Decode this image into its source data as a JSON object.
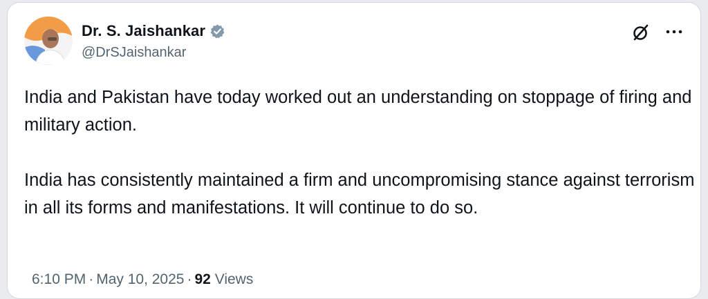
{
  "author": {
    "name": "Dr. S. Jaishankar",
    "handle": "@DrSJaishankar",
    "verified": true
  },
  "tweet": {
    "paragraphs": [
      "India and Pakistan have today worked out an understanding on stoppage of firing and military action.",
      "India has consistently maintained a firm and uncompromising stance against terrorism in all its forms and manifestations. It will continue to do so."
    ]
  },
  "meta": {
    "time": "6:10 PM",
    "date": "May 10, 2025",
    "separator": "·",
    "views_count": "92",
    "views_label": "Views"
  },
  "icons": {
    "verified": "verified-badge-icon",
    "grok": "grok-icon",
    "more": "more-options-icon"
  },
  "colors": {
    "text": "#0f1419",
    "secondary": "#536471",
    "verified_badge": "#829aab",
    "saffron": "#f28c28",
    "card_border": "#d4d8dd"
  }
}
